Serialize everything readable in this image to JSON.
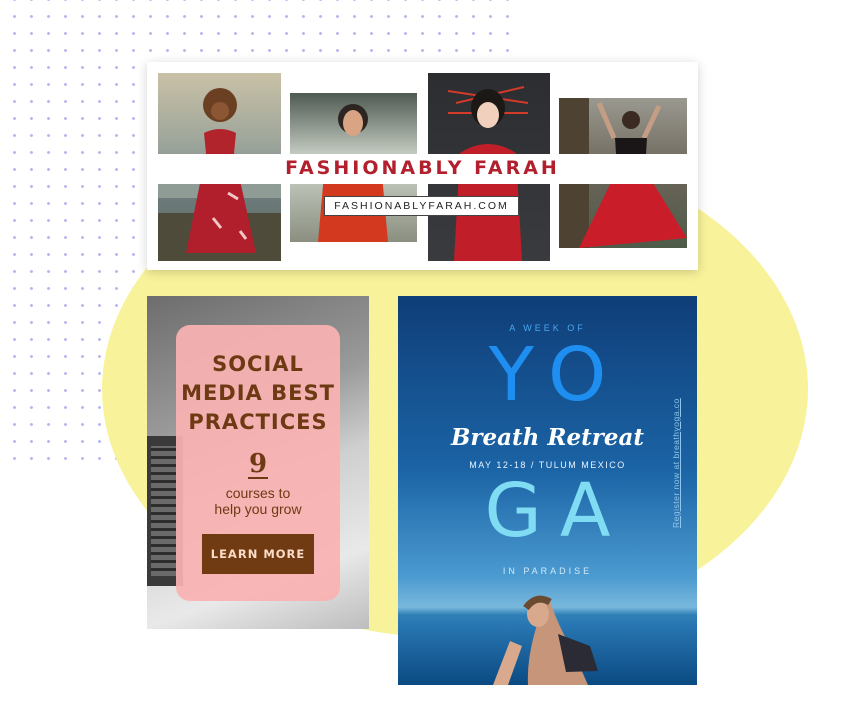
{
  "banner": {
    "brand_name": "FASHIONABLY FARAH",
    "brand_url": "FASHIONABLYFARAH.COM"
  },
  "social_card": {
    "title_line1": "SOCIAL",
    "title_line2": "MEDIA BEST",
    "title_line3": "PRACTICES",
    "number": "9",
    "subtitle_line1": "courses to",
    "subtitle_line2": "help you grow",
    "button_label": "LEARN MORE"
  },
  "yoga_card": {
    "kicker": "A WEEK OF",
    "big_top": "YO",
    "script_title": "Breath Retreat",
    "dates": "MAY 12-18 / TULUM MEXICO",
    "big_bottom": "GA",
    "footer": "IN PARADISE",
    "vertical_link": "Register now at breathyoga.co"
  },
  "colors": {
    "circle": "#f8f29a",
    "brand_red": "#b2202e",
    "pink_panel": "#fab2b2",
    "brown": "#6e3a14",
    "yoga_blue": "#1e8ff0"
  }
}
